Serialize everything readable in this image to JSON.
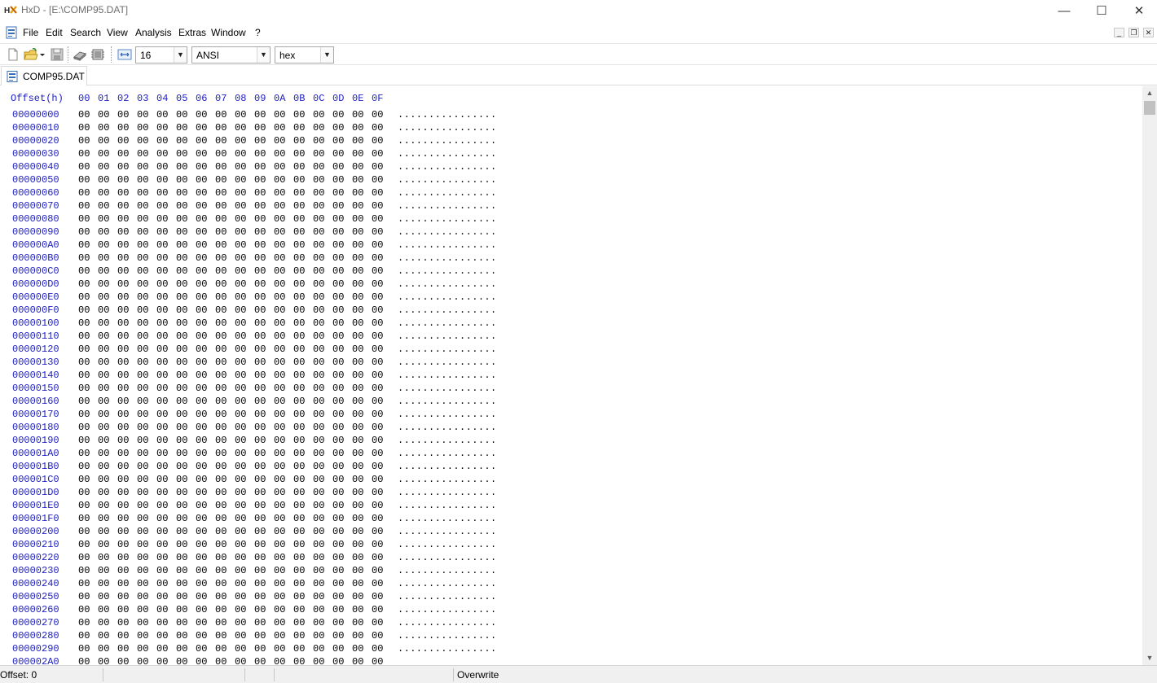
{
  "window": {
    "title": "HxD - [E:\\COMP95.DAT]",
    "app_icon": "hxd-logo-icon",
    "controls": {
      "minimize": "—",
      "maximize": "☐",
      "close": "✕"
    }
  },
  "menu": {
    "items": [
      "File",
      "Edit",
      "Search",
      "View",
      "Analysis",
      "Extras",
      "Window",
      "?"
    ],
    "mdi_controls": {
      "minimize": "_",
      "restore": "❐",
      "close": "✕"
    }
  },
  "toolbar": {
    "icons": [
      "new-file-icon",
      "open-file-icon",
      "open-dropdown-icon",
      "save-icon",
      "open-disk-icon",
      "open-ram-icon",
      "bytes-per-row-icon"
    ],
    "bytes_per_row": "16",
    "charset": "ANSI",
    "offset_base": "hex"
  },
  "tabs": [
    {
      "label": "COMP95.DAT",
      "icon": "document-icon"
    }
  ],
  "hex_view": {
    "offset_header": "Offset(h)",
    "columns": [
      "00",
      "01",
      "02",
      "03",
      "04",
      "05",
      "06",
      "07",
      "08",
      "09",
      "0A",
      "0B",
      "0C",
      "0D",
      "0E",
      "0F"
    ],
    "rows": [
      {
        "offset": "00000000",
        "bytes": [
          "00",
          "00",
          "00",
          "00",
          "00",
          "00",
          "00",
          "00",
          "00",
          "00",
          "00",
          "00",
          "00",
          "00",
          "00",
          "00"
        ],
        "text": "................"
      },
      {
        "offset": "00000010",
        "bytes": [
          "00",
          "00",
          "00",
          "00",
          "00",
          "00",
          "00",
          "00",
          "00",
          "00",
          "00",
          "00",
          "00",
          "00",
          "00",
          "00"
        ],
        "text": "................"
      },
      {
        "offset": "00000020",
        "bytes": [
          "00",
          "00",
          "00",
          "00",
          "00",
          "00",
          "00",
          "00",
          "00",
          "00",
          "00",
          "00",
          "00",
          "00",
          "00",
          "00"
        ],
        "text": "................"
      },
      {
        "offset": "00000030",
        "bytes": [
          "00",
          "00",
          "00",
          "00",
          "00",
          "00",
          "00",
          "00",
          "00",
          "00",
          "00",
          "00",
          "00",
          "00",
          "00",
          "00"
        ],
        "text": "................"
      },
      {
        "offset": "00000040",
        "bytes": [
          "00",
          "00",
          "00",
          "00",
          "00",
          "00",
          "00",
          "00",
          "00",
          "00",
          "00",
          "00",
          "00",
          "00",
          "00",
          "00"
        ],
        "text": "................"
      },
      {
        "offset": "00000050",
        "bytes": [
          "00",
          "00",
          "00",
          "00",
          "00",
          "00",
          "00",
          "00",
          "00",
          "00",
          "00",
          "00",
          "00",
          "00",
          "00",
          "00"
        ],
        "text": "................"
      },
      {
        "offset": "00000060",
        "bytes": [
          "00",
          "00",
          "00",
          "00",
          "00",
          "00",
          "00",
          "00",
          "00",
          "00",
          "00",
          "00",
          "00",
          "00",
          "00",
          "00"
        ],
        "text": "................"
      },
      {
        "offset": "00000070",
        "bytes": [
          "00",
          "00",
          "00",
          "00",
          "00",
          "00",
          "00",
          "00",
          "00",
          "00",
          "00",
          "00",
          "00",
          "00",
          "00",
          "00"
        ],
        "text": "................"
      },
      {
        "offset": "00000080",
        "bytes": [
          "00",
          "00",
          "00",
          "00",
          "00",
          "00",
          "00",
          "00",
          "00",
          "00",
          "00",
          "00",
          "00",
          "00",
          "00",
          "00"
        ],
        "text": "................"
      },
      {
        "offset": "00000090",
        "bytes": [
          "00",
          "00",
          "00",
          "00",
          "00",
          "00",
          "00",
          "00",
          "00",
          "00",
          "00",
          "00",
          "00",
          "00",
          "00",
          "00"
        ],
        "text": "................"
      },
      {
        "offset": "000000A0",
        "bytes": [
          "00",
          "00",
          "00",
          "00",
          "00",
          "00",
          "00",
          "00",
          "00",
          "00",
          "00",
          "00",
          "00",
          "00",
          "00",
          "00"
        ],
        "text": "................"
      },
      {
        "offset": "000000B0",
        "bytes": [
          "00",
          "00",
          "00",
          "00",
          "00",
          "00",
          "00",
          "00",
          "00",
          "00",
          "00",
          "00",
          "00",
          "00",
          "00",
          "00"
        ],
        "text": "................"
      },
      {
        "offset": "000000C0",
        "bytes": [
          "00",
          "00",
          "00",
          "00",
          "00",
          "00",
          "00",
          "00",
          "00",
          "00",
          "00",
          "00",
          "00",
          "00",
          "00",
          "00"
        ],
        "text": "................"
      },
      {
        "offset": "000000D0",
        "bytes": [
          "00",
          "00",
          "00",
          "00",
          "00",
          "00",
          "00",
          "00",
          "00",
          "00",
          "00",
          "00",
          "00",
          "00",
          "00",
          "00"
        ],
        "text": "................"
      },
      {
        "offset": "000000E0",
        "bytes": [
          "00",
          "00",
          "00",
          "00",
          "00",
          "00",
          "00",
          "00",
          "00",
          "00",
          "00",
          "00",
          "00",
          "00",
          "00",
          "00"
        ],
        "text": "................"
      },
      {
        "offset": "000000F0",
        "bytes": [
          "00",
          "00",
          "00",
          "00",
          "00",
          "00",
          "00",
          "00",
          "00",
          "00",
          "00",
          "00",
          "00",
          "00",
          "00",
          "00"
        ],
        "text": "................"
      },
      {
        "offset": "00000100",
        "bytes": [
          "00",
          "00",
          "00",
          "00",
          "00",
          "00",
          "00",
          "00",
          "00",
          "00",
          "00",
          "00",
          "00",
          "00",
          "00",
          "00"
        ],
        "text": "................"
      },
      {
        "offset": "00000110",
        "bytes": [
          "00",
          "00",
          "00",
          "00",
          "00",
          "00",
          "00",
          "00",
          "00",
          "00",
          "00",
          "00",
          "00",
          "00",
          "00",
          "00"
        ],
        "text": "................"
      },
      {
        "offset": "00000120",
        "bytes": [
          "00",
          "00",
          "00",
          "00",
          "00",
          "00",
          "00",
          "00",
          "00",
          "00",
          "00",
          "00",
          "00",
          "00",
          "00",
          "00"
        ],
        "text": "................"
      },
      {
        "offset": "00000130",
        "bytes": [
          "00",
          "00",
          "00",
          "00",
          "00",
          "00",
          "00",
          "00",
          "00",
          "00",
          "00",
          "00",
          "00",
          "00",
          "00",
          "00"
        ],
        "text": "................"
      },
      {
        "offset": "00000140",
        "bytes": [
          "00",
          "00",
          "00",
          "00",
          "00",
          "00",
          "00",
          "00",
          "00",
          "00",
          "00",
          "00",
          "00",
          "00",
          "00",
          "00"
        ],
        "text": "................"
      },
      {
        "offset": "00000150",
        "bytes": [
          "00",
          "00",
          "00",
          "00",
          "00",
          "00",
          "00",
          "00",
          "00",
          "00",
          "00",
          "00",
          "00",
          "00",
          "00",
          "00"
        ],
        "text": "................"
      },
      {
        "offset": "00000160",
        "bytes": [
          "00",
          "00",
          "00",
          "00",
          "00",
          "00",
          "00",
          "00",
          "00",
          "00",
          "00",
          "00",
          "00",
          "00",
          "00",
          "00"
        ],
        "text": "................"
      },
      {
        "offset": "00000170",
        "bytes": [
          "00",
          "00",
          "00",
          "00",
          "00",
          "00",
          "00",
          "00",
          "00",
          "00",
          "00",
          "00",
          "00",
          "00",
          "00",
          "00"
        ],
        "text": "................"
      },
      {
        "offset": "00000180",
        "bytes": [
          "00",
          "00",
          "00",
          "00",
          "00",
          "00",
          "00",
          "00",
          "00",
          "00",
          "00",
          "00",
          "00",
          "00",
          "00",
          "00"
        ],
        "text": "................"
      },
      {
        "offset": "00000190",
        "bytes": [
          "00",
          "00",
          "00",
          "00",
          "00",
          "00",
          "00",
          "00",
          "00",
          "00",
          "00",
          "00",
          "00",
          "00",
          "00",
          "00"
        ],
        "text": "................"
      },
      {
        "offset": "000001A0",
        "bytes": [
          "00",
          "00",
          "00",
          "00",
          "00",
          "00",
          "00",
          "00",
          "00",
          "00",
          "00",
          "00",
          "00",
          "00",
          "00",
          "00"
        ],
        "text": "................"
      },
      {
        "offset": "000001B0",
        "bytes": [
          "00",
          "00",
          "00",
          "00",
          "00",
          "00",
          "00",
          "00",
          "00",
          "00",
          "00",
          "00",
          "00",
          "00",
          "00",
          "00"
        ],
        "text": "................"
      },
      {
        "offset": "000001C0",
        "bytes": [
          "00",
          "00",
          "00",
          "00",
          "00",
          "00",
          "00",
          "00",
          "00",
          "00",
          "00",
          "00",
          "00",
          "00",
          "00",
          "00"
        ],
        "text": "................"
      },
      {
        "offset": "000001D0",
        "bytes": [
          "00",
          "00",
          "00",
          "00",
          "00",
          "00",
          "00",
          "00",
          "00",
          "00",
          "00",
          "00",
          "00",
          "00",
          "00",
          "00"
        ],
        "text": "................"
      },
      {
        "offset": "000001E0",
        "bytes": [
          "00",
          "00",
          "00",
          "00",
          "00",
          "00",
          "00",
          "00",
          "00",
          "00",
          "00",
          "00",
          "00",
          "00",
          "00",
          "00"
        ],
        "text": "................"
      },
      {
        "offset": "000001F0",
        "bytes": [
          "00",
          "00",
          "00",
          "00",
          "00",
          "00",
          "00",
          "00",
          "00",
          "00",
          "00",
          "00",
          "00",
          "00",
          "00",
          "00"
        ],
        "text": "................"
      },
      {
        "offset": "00000200",
        "bytes": [
          "00",
          "00",
          "00",
          "00",
          "00",
          "00",
          "00",
          "00",
          "00",
          "00",
          "00",
          "00",
          "00",
          "00",
          "00",
          "00"
        ],
        "text": "................"
      },
      {
        "offset": "00000210",
        "bytes": [
          "00",
          "00",
          "00",
          "00",
          "00",
          "00",
          "00",
          "00",
          "00",
          "00",
          "00",
          "00",
          "00",
          "00",
          "00",
          "00"
        ],
        "text": "................"
      },
      {
        "offset": "00000220",
        "bytes": [
          "00",
          "00",
          "00",
          "00",
          "00",
          "00",
          "00",
          "00",
          "00",
          "00",
          "00",
          "00",
          "00",
          "00",
          "00",
          "00"
        ],
        "text": "................"
      },
      {
        "offset": "00000230",
        "bytes": [
          "00",
          "00",
          "00",
          "00",
          "00",
          "00",
          "00",
          "00",
          "00",
          "00",
          "00",
          "00",
          "00",
          "00",
          "00",
          "00"
        ],
        "text": "................"
      },
      {
        "offset": "00000240",
        "bytes": [
          "00",
          "00",
          "00",
          "00",
          "00",
          "00",
          "00",
          "00",
          "00",
          "00",
          "00",
          "00",
          "00",
          "00",
          "00",
          "00"
        ],
        "text": "................"
      },
      {
        "offset": "00000250",
        "bytes": [
          "00",
          "00",
          "00",
          "00",
          "00",
          "00",
          "00",
          "00",
          "00",
          "00",
          "00",
          "00",
          "00",
          "00",
          "00",
          "00"
        ],
        "text": "................"
      },
      {
        "offset": "00000260",
        "bytes": [
          "00",
          "00",
          "00",
          "00",
          "00",
          "00",
          "00",
          "00",
          "00",
          "00",
          "00",
          "00",
          "00",
          "00",
          "00",
          "00"
        ],
        "text": "................"
      },
      {
        "offset": "00000270",
        "bytes": [
          "00",
          "00",
          "00",
          "00",
          "00",
          "00",
          "00",
          "00",
          "00",
          "00",
          "00",
          "00",
          "00",
          "00",
          "00",
          "00"
        ],
        "text": "................"
      },
      {
        "offset": "00000280",
        "bytes": [
          "00",
          "00",
          "00",
          "00",
          "00",
          "00",
          "00",
          "00",
          "00",
          "00",
          "00",
          "00",
          "00",
          "00",
          "00",
          "00"
        ],
        "text": "................"
      },
      {
        "offset": "00000290",
        "bytes": [
          "00",
          "00",
          "00",
          "00",
          "00",
          "00",
          "00",
          "00",
          "00",
          "00",
          "00",
          "00",
          "00",
          "00",
          "00",
          "00"
        ],
        "text": "................"
      },
      {
        "offset": "000002A0",
        "bytes": [
          "00",
          "00",
          "00",
          "00",
          "00",
          "00",
          "00",
          "00",
          "00",
          "00",
          "00",
          "00",
          "00",
          "00",
          "00",
          "00"
        ],
        "text": ""
      }
    ]
  },
  "scrollbar": {
    "up": "▲",
    "down": "▼"
  },
  "status": {
    "offset": "Offset: 0",
    "mode": "Overwrite"
  },
  "colors": {
    "offset_blue": "#2020c0",
    "byte_text": "#000000",
    "title_gray": "#6d6d6d"
  }
}
